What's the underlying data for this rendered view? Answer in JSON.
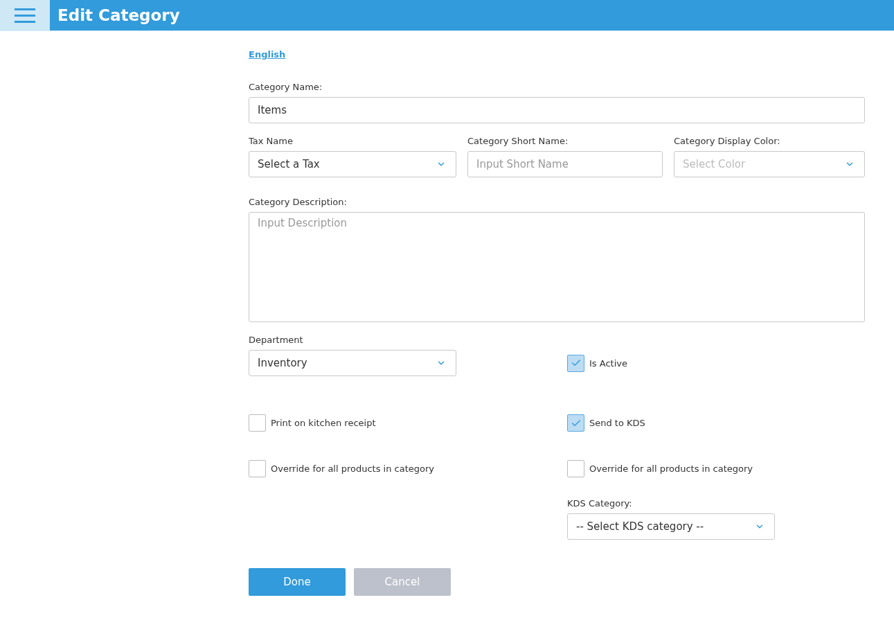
{
  "header": {
    "title": "Edit Category"
  },
  "language_link": "English",
  "category_name": {
    "label": "Category Name:",
    "value": "Items"
  },
  "tax": {
    "label": "Tax Name",
    "value": "Select a Tax"
  },
  "short_name": {
    "label": "Category Short Name:",
    "placeholder": "Input Short Name"
  },
  "display_color": {
    "label": "Category Display Color:",
    "placeholder": "Select Color"
  },
  "description": {
    "label": "Category Description:",
    "placeholder": "Input Description"
  },
  "department": {
    "label": "Department",
    "value": "Inventory"
  },
  "is_active": {
    "label": "Is Active",
    "checked": true
  },
  "checkbox_rows": [
    [
      {
        "label": "Print on kitchen receipt",
        "checked": false
      },
      {
        "label": "Send to KDS",
        "checked": true
      }
    ],
    [
      {
        "label": "Override for all products in category",
        "checked": false
      },
      {
        "label": "Override for all products in category",
        "checked": false
      }
    ]
  ],
  "kds_category": {
    "label": "KDS Category:",
    "value": "-- Select KDS category --"
  },
  "buttons": [
    {
      "label": "Done",
      "kind": "primary"
    },
    {
      "label": "Cancel",
      "kind": "disabled"
    }
  ]
}
